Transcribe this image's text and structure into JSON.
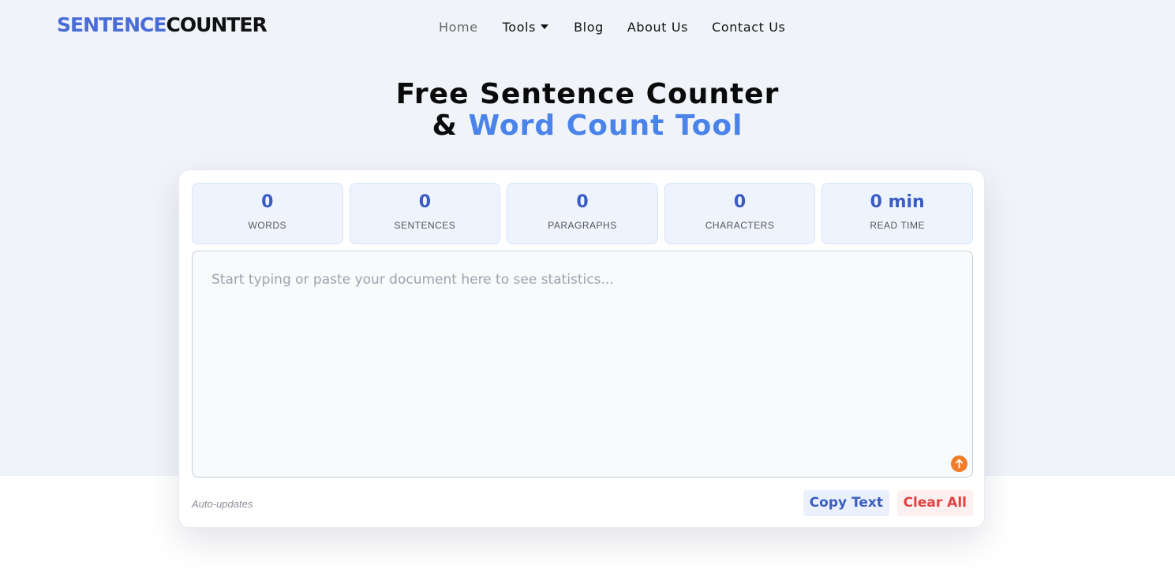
{
  "logo": {
    "part1": "SENTENCE",
    "part2": "COUNTER"
  },
  "nav": {
    "items": [
      {
        "label": "Home"
      },
      {
        "label": "Tools"
      },
      {
        "label": "Blog"
      },
      {
        "label": "About Us"
      },
      {
        "label": "Contact Us"
      }
    ]
  },
  "hero": {
    "line1": "Free Sentence Counter",
    "line2_prefix": "& ",
    "line2_accent": "Word Count Tool"
  },
  "stats": [
    {
      "value": "0",
      "label": "WORDS"
    },
    {
      "value": "0",
      "label": "SENTENCES"
    },
    {
      "value": "0",
      "label": "PARAGRAPHS"
    },
    {
      "value": "0",
      "label": "CHARACTERS"
    },
    {
      "value": "0 min",
      "label": "READ TIME"
    }
  ],
  "editor": {
    "placeholder": "Start typing or paste your document here to see statistics..."
  },
  "footer": {
    "auto_label": "Auto-updates",
    "copy_label": "Copy Text",
    "clear_label": "Clear All"
  },
  "colors": {
    "brand": "#4a6cd6",
    "accent": "#4a84ea",
    "upload": "#f07c2a",
    "danger": "#e24242"
  }
}
